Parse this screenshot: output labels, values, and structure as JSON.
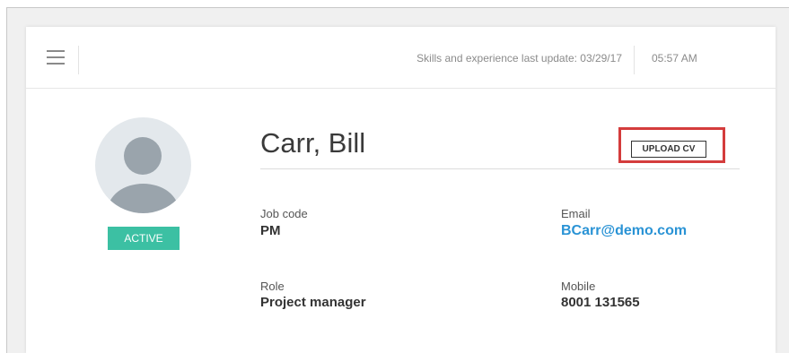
{
  "header": {
    "last_update_label": "Skills and experience last update: 03/29/17",
    "time": "05:57 AM"
  },
  "icons": {
    "menu": "hamburger-menu-icon",
    "avatar": "user-placeholder-icon"
  },
  "profile": {
    "name": "Carr, Bill",
    "status": "ACTIVE",
    "upload_label": "UPLOAD CV",
    "fields": {
      "job_code_label": "Job code",
      "job_code": "PM",
      "email_label": "Email",
      "email": "BCarr@demo.com",
      "role_label": "Role",
      "role": "Project manager",
      "mobile_label": "Mobile",
      "mobile": "8001 131565"
    }
  },
  "colors": {
    "status_badge": "#3cc0a3",
    "email_link": "#2a93d5",
    "highlight_box": "#d43c3c"
  }
}
